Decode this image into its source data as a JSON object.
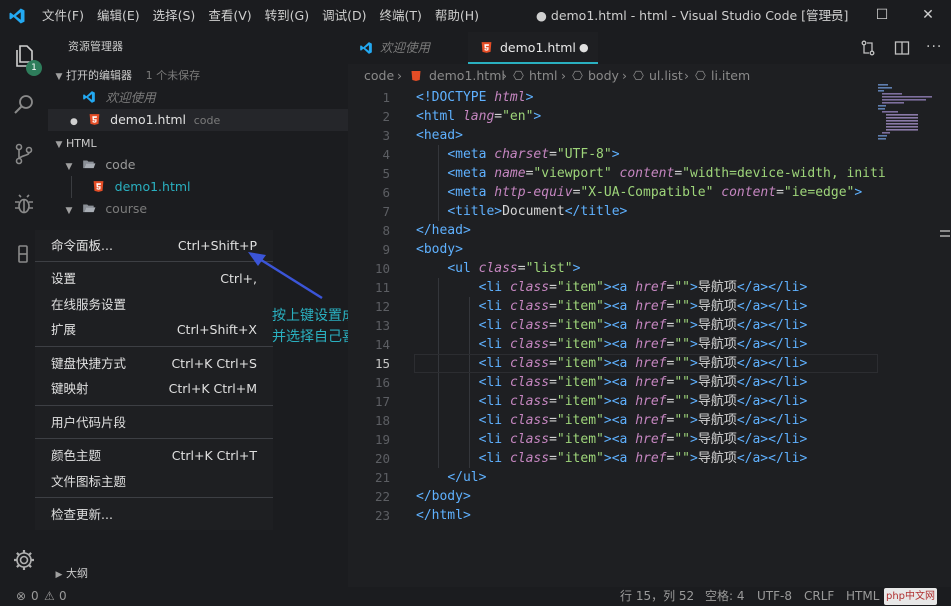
{
  "titlebar": {
    "menu": [
      "文件(F)",
      "编辑(E)",
      "选择(S)",
      "查看(V)",
      "转到(G)",
      "调试(D)",
      "终端(T)",
      "帮助(H)"
    ],
    "window_title": "● demo1.html - html - Visual Studio Code [管理员]",
    "minimize": "—",
    "maximize": "☐",
    "close": "✕"
  },
  "activity": {
    "badge": "1"
  },
  "sidebar": {
    "title": "资源管理器",
    "open_editors": {
      "label": "打开的编辑器",
      "unsaved": "1 个未保存"
    },
    "open_items": [
      {
        "name": "欢迎使用",
        "icon": "vscode-logo-icon"
      },
      {
        "name": "demo1.html",
        "folder": "code",
        "icon": "html5-icon"
      }
    ],
    "workspace": "HTML",
    "tree": [
      {
        "name": "code",
        "type": "folder"
      },
      {
        "name": "demo1.html",
        "type": "file"
      },
      {
        "name": "course",
        "type": "folder"
      }
    ],
    "outline": "大纲"
  },
  "context_menu": {
    "items": [
      {
        "label": "命令面板...",
        "shortcut": "Ctrl+Shift+P"
      },
      {
        "label": "设置",
        "shortcut": "Ctrl+,"
      },
      {
        "label": "在线服务设置",
        "shortcut": ""
      },
      {
        "label": "扩展",
        "shortcut": "Ctrl+Shift+X"
      },
      {
        "label": "键盘快捷方式",
        "shortcut": "Ctrl+K Ctrl+S"
      },
      {
        "label": "键映射",
        "shortcut": "Ctrl+K Ctrl+M"
      },
      {
        "label": "用户代码片段",
        "shortcut": ""
      },
      {
        "label": "颜色主题",
        "shortcut": "Ctrl+K Ctrl+T"
      },
      {
        "label": "文件图标主题",
        "shortcut": ""
      },
      {
        "label": "检查更新...",
        "shortcut": ""
      }
    ]
  },
  "annotation": {
    "line1": "按上键设置成中文版本",
    "line2": "并选择自己喜欢的主题"
  },
  "tabs": [
    {
      "label": "欢迎使用",
      "active": false
    },
    {
      "label": "demo1.html",
      "active": true,
      "dirty_mark": "●"
    }
  ],
  "breadcrumb": [
    "code",
    "demo1.html",
    "html",
    "body",
    "ul.list",
    "li.item"
  ],
  "editor": {
    "current_line": 15,
    "lines": [
      [
        [
          "tg",
          "<!DOCTYPE "
        ],
        [
          "at",
          "html"
        ],
        [
          "tg",
          ">"
        ]
      ],
      [
        [
          "tg",
          "<html "
        ],
        [
          "at",
          "lang"
        ],
        [
          "tx",
          "="
        ],
        [
          "st",
          "\"en\""
        ],
        [
          "tg",
          ">"
        ]
      ],
      [
        [
          "tg",
          "<head>"
        ]
      ],
      [
        [
          "tx",
          "    "
        ],
        [
          "tg",
          "<meta "
        ],
        [
          "at",
          "charset"
        ],
        [
          "tx",
          "="
        ],
        [
          "st",
          "\"UTF-8\""
        ],
        [
          "tg",
          ">"
        ]
      ],
      [
        [
          "tx",
          "    "
        ],
        [
          "tg",
          "<meta "
        ],
        [
          "at",
          "name"
        ],
        [
          "tx",
          "="
        ],
        [
          "st",
          "\"viewport\""
        ],
        [
          "tx",
          " "
        ],
        [
          "at",
          "content"
        ],
        [
          "tx",
          "="
        ],
        [
          "st",
          "\"width=device-width, initi"
        ]
      ],
      [
        [
          "tx",
          "    "
        ],
        [
          "tg",
          "<meta "
        ],
        [
          "at",
          "http-equiv"
        ],
        [
          "tx",
          "="
        ],
        [
          "st",
          "\"X-UA-Compatible\""
        ],
        [
          "tx",
          " "
        ],
        [
          "at",
          "content"
        ],
        [
          "tx",
          "="
        ],
        [
          "st",
          "\"ie=edge\""
        ],
        [
          "tg",
          ">"
        ]
      ],
      [
        [
          "tx",
          "    "
        ],
        [
          "tg",
          "<title>"
        ],
        [
          "tx",
          "Document"
        ],
        [
          "tg",
          "</title>"
        ]
      ],
      [
        [
          "tg",
          "</head>"
        ]
      ],
      [
        [
          "tg",
          "<body>"
        ]
      ],
      [
        [
          "tx",
          "    "
        ],
        [
          "tg",
          "<ul "
        ],
        [
          "at",
          "class"
        ],
        [
          "tx",
          "="
        ],
        [
          "st",
          "\"list\""
        ],
        [
          "tg",
          ">"
        ]
      ],
      [
        [
          "tx",
          "        "
        ],
        [
          "tg",
          "<li "
        ],
        [
          "at",
          "class"
        ],
        [
          "tx",
          "="
        ],
        [
          "st",
          "\"item\""
        ],
        [
          "tg",
          "><a "
        ],
        [
          "at",
          "href"
        ],
        [
          "tx",
          "="
        ],
        [
          "st",
          "\"\""
        ],
        [
          "tg",
          ">"
        ],
        [
          "tx",
          "导航项"
        ],
        [
          "tg",
          "</a></li>"
        ]
      ],
      [
        [
          "tx",
          "        "
        ],
        [
          "tg",
          "<li "
        ],
        [
          "at",
          "class"
        ],
        [
          "tx",
          "="
        ],
        [
          "st",
          "\"item\""
        ],
        [
          "tg",
          "><a "
        ],
        [
          "at",
          "href"
        ],
        [
          "tx",
          "="
        ],
        [
          "st",
          "\"\""
        ],
        [
          "tg",
          ">"
        ],
        [
          "tx",
          "导航项"
        ],
        [
          "tg",
          "</a></li>"
        ]
      ],
      [
        [
          "tx",
          "        "
        ],
        [
          "tg",
          "<li "
        ],
        [
          "at",
          "class"
        ],
        [
          "tx",
          "="
        ],
        [
          "st",
          "\"item\""
        ],
        [
          "tg",
          "><a "
        ],
        [
          "at",
          "href"
        ],
        [
          "tx",
          "="
        ],
        [
          "st",
          "\"\""
        ],
        [
          "tg",
          ">"
        ],
        [
          "tx",
          "导航项"
        ],
        [
          "tg",
          "</a></li>"
        ]
      ],
      [
        [
          "tx",
          "        "
        ],
        [
          "tg",
          "<li "
        ],
        [
          "at",
          "class"
        ],
        [
          "tx",
          "="
        ],
        [
          "st",
          "\"item\""
        ],
        [
          "tg",
          "><a "
        ],
        [
          "at",
          "href"
        ],
        [
          "tx",
          "="
        ],
        [
          "st",
          "\"\""
        ],
        [
          "tg",
          ">"
        ],
        [
          "tx",
          "导航项"
        ],
        [
          "tg",
          "</a></li>"
        ]
      ],
      [
        [
          "tx",
          "        "
        ],
        [
          "tg",
          "<li "
        ],
        [
          "at",
          "class"
        ],
        [
          "tx",
          "="
        ],
        [
          "st",
          "\"item\""
        ],
        [
          "tg",
          "><a "
        ],
        [
          "at",
          "href"
        ],
        [
          "tx",
          "="
        ],
        [
          "st",
          "\"\""
        ],
        [
          "tg",
          ">"
        ],
        [
          "tx",
          "导航项"
        ],
        [
          "tg",
          "</a></li>"
        ]
      ],
      [
        [
          "tx",
          "        "
        ],
        [
          "tg",
          "<li "
        ],
        [
          "at",
          "class"
        ],
        [
          "tx",
          "="
        ],
        [
          "st",
          "\"item\""
        ],
        [
          "tg",
          "><a "
        ],
        [
          "at",
          "href"
        ],
        [
          "tx",
          "="
        ],
        [
          "st",
          "\"\""
        ],
        [
          "tg",
          ">"
        ],
        [
          "tx",
          "导航项"
        ],
        [
          "tg",
          "</a></li>"
        ]
      ],
      [
        [
          "tx",
          "        "
        ],
        [
          "tg",
          "<li "
        ],
        [
          "at",
          "class"
        ],
        [
          "tx",
          "="
        ],
        [
          "st",
          "\"item\""
        ],
        [
          "tg",
          "><a "
        ],
        [
          "at",
          "href"
        ],
        [
          "tx",
          "="
        ],
        [
          "st",
          "\"\""
        ],
        [
          "tg",
          ">"
        ],
        [
          "tx",
          "导航项"
        ],
        [
          "tg",
          "</a></li>"
        ]
      ],
      [
        [
          "tx",
          "        "
        ],
        [
          "tg",
          "<li "
        ],
        [
          "at",
          "class"
        ],
        [
          "tx",
          "="
        ],
        [
          "st",
          "\"item\""
        ],
        [
          "tg",
          "><a "
        ],
        [
          "at",
          "href"
        ],
        [
          "tx",
          "="
        ],
        [
          "st",
          "\"\""
        ],
        [
          "tg",
          ">"
        ],
        [
          "tx",
          "导航项"
        ],
        [
          "tg",
          "</a></li>"
        ]
      ],
      [
        [
          "tx",
          "        "
        ],
        [
          "tg",
          "<li "
        ],
        [
          "at",
          "class"
        ],
        [
          "tx",
          "="
        ],
        [
          "st",
          "\"item\""
        ],
        [
          "tg",
          "><a "
        ],
        [
          "at",
          "href"
        ],
        [
          "tx",
          "="
        ],
        [
          "st",
          "\"\""
        ],
        [
          "tg",
          ">"
        ],
        [
          "tx",
          "导航项"
        ],
        [
          "tg",
          "</a></li>"
        ]
      ],
      [
        [
          "tx",
          "        "
        ],
        [
          "tg",
          "<li "
        ],
        [
          "at",
          "class"
        ],
        [
          "tx",
          "="
        ],
        [
          "st",
          "\"item\""
        ],
        [
          "tg",
          "><a "
        ],
        [
          "at",
          "href"
        ],
        [
          "tx",
          "="
        ],
        [
          "st",
          "\"\""
        ],
        [
          "tg",
          ">"
        ],
        [
          "tx",
          "导航项"
        ],
        [
          "tg",
          "</a></li>"
        ]
      ],
      [
        [
          "tx",
          "    "
        ],
        [
          "tg",
          "</ul>"
        ]
      ],
      [
        [
          "tg",
          "</body>"
        ]
      ],
      [
        [
          "tg",
          "</html>"
        ]
      ]
    ]
  },
  "statusbar": {
    "errors": "0",
    "warnings": "0",
    "position": "行 15，列 52",
    "spaces": "空格: 4",
    "encoding": "UTF-8",
    "eol": "CRLF",
    "language": "HTML",
    "watermark": "php中文网"
  },
  "colors": {
    "accent": "#2ab0c0",
    "html_icon": "#e44d26",
    "vscode_blue": "#23a9f2",
    "tag": "#5fb1ff",
    "attribute": "#c586c0",
    "string": "#9ed57a"
  }
}
